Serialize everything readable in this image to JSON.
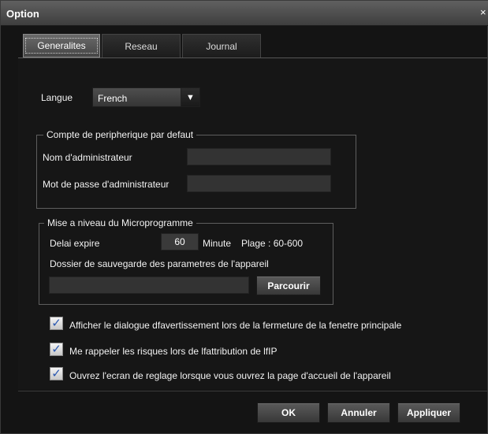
{
  "window": {
    "title": "Option",
    "close_glyph": "×"
  },
  "tabs": [
    {
      "label": "Generalites",
      "active": true
    },
    {
      "label": "Reseau",
      "active": false
    },
    {
      "label": "Journal",
      "active": false
    }
  ],
  "language": {
    "label": "Langue",
    "selected": "French",
    "arrow_icon": "triangle-down-icon"
  },
  "default_account": {
    "legend": "Compte de peripherique par defaut",
    "admin_name_label": "Nom d'administrateur",
    "admin_name_value": "",
    "admin_password_label": "Mot de passe d'administrateur",
    "admin_password_value": ""
  },
  "firmware": {
    "legend": "Mise a niveau du Microprogramme",
    "timeout_label": "Delai expire",
    "timeout_value": "60",
    "timeout_unit": "Minute",
    "range_text": "Plage : 60-600",
    "folder_label": "Dossier de sauvegarde des parametres de l'appareil",
    "folder_value": "",
    "browse_label": "Parcourir"
  },
  "options": [
    {
      "label": "Afficher le dialogue dfavertissement lors de la fermeture de la fenetre principale",
      "checked": true
    },
    {
      "label": "Me rappeler les risques lors de lfattribution de lfIP",
      "checked": true
    },
    {
      "label": "Ouvrez l'ecran de reglage lorsque vous ouvrez la page d'accueil de l'appareil",
      "checked": true
    }
  ],
  "footer": {
    "ok_label": "OK",
    "cancel_label": "Annuler",
    "apply_label": "Appliquer"
  },
  "colors": {
    "window_bg": "#141414",
    "titlebar": "#505050",
    "check_accent": "#2a58b0"
  }
}
